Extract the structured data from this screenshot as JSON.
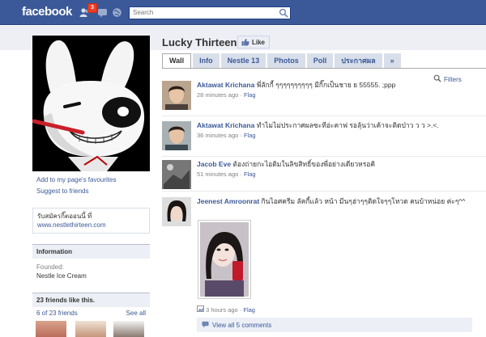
{
  "topbar": {
    "logo": "facebook",
    "notification_count": "3",
    "search_placeholder": "Search"
  },
  "page": {
    "title": "Lucky Thirteen",
    "like_label": "Like"
  },
  "tabs": [
    {
      "label": "Wall"
    },
    {
      "label": "Info"
    },
    {
      "label": "Nestle 13"
    },
    {
      "label": "Photos"
    },
    {
      "label": "Poll"
    },
    {
      "label": "ประกาศผล"
    },
    {
      "label": "»"
    }
  ],
  "filters_label": "Filters",
  "left": {
    "add_favourites": "Add to my page's favourites",
    "suggest_friends": "Suggest to friends",
    "website_text": "รับสมัครกิ๊ตออนนี้ ที่",
    "website_link": "www.nestlethirteen.com",
    "info_title": "Information",
    "founded_label": "Founded:",
    "founded_value": "Nestle Ice Cream",
    "friends_title": "23 friends like this.",
    "friends_count": "6 of 23 friends",
    "see_all": "See all"
  },
  "posts": [
    {
      "author": "Aktawat Krichana",
      "text": "พี่ลักกี้ ๆๆๆๆๆๆๆๆๆๆ มีกิ๊กเป็นชาย ย 55555. ;ppp",
      "time": "28 minutes ago",
      "flag": "Flag"
    },
    {
      "author": "Aktawat Krichana",
      "text": "ทำไมไม่ประกาศผลซะทีอ่ะคาฟ รอลุ้นว่าเค้าจะติดป่าว ว ว >.<.",
      "time": "36 minutes ago",
      "flag": "Flag"
    },
    {
      "author": "Jacob Eve",
      "text": "ต้องถ่ายกะไอติมในลิขสิทธิ์ของพี่อย่างเดียวหรอคิ",
      "time": "51 minutes ago",
      "flag": "Flag"
    },
    {
      "author": "Jeenest Amroonrat",
      "text": "กินไอศครีม ลัคกี้แล้ว หน้า มีนๆฮ่าๆๆติดใจๆๆโหวด คนบ้าหน่อย ค่ะๆ^^",
      "time": "3 hours ago",
      "flag": "Flag"
    }
  ],
  "comments_label": "View all 5 comments",
  "colors": {
    "brand": "#3b5998",
    "link": "#3b5998",
    "badge": "#f03d25"
  }
}
